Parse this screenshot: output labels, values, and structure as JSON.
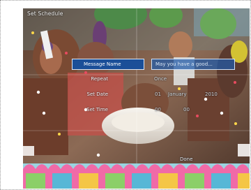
{
  "screen": {
    "title": "Set Schedule",
    "fields": [
      {
        "label": "Message Name",
        "value": "May you have a good..."
      },
      {
        "label": "Repeat",
        "value": "Once"
      },
      {
        "label": "Set Date",
        "day": "01",
        "month": "January",
        "year": "2010"
      },
      {
        "label": "Set Time",
        "hour": "00",
        "minute": "00"
      }
    ],
    "done_label": "Done"
  },
  "colors": {
    "selected_bg": "#1b4f98",
    "value_box_bg": "#2b66b3",
    "text": "#e9eef2"
  }
}
